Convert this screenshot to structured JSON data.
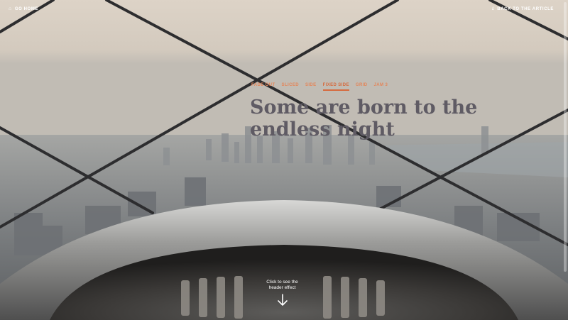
{
  "nav": {
    "home_label": "GO HOME",
    "home_icon": "home-icon",
    "back_label": "BACK TO THE ARTICLE",
    "back_icon": "drop-icon"
  },
  "effects": {
    "tabs": [
      {
        "label": "FADE OUT",
        "active": false
      },
      {
        "label": "SLICED",
        "active": false
      },
      {
        "label": "SIDE",
        "active": false
      },
      {
        "label": "FIXED SIDE",
        "active": true
      },
      {
        "label": "GRID",
        "active": false
      },
      {
        "label": "JAM 3",
        "active": false
      }
    ],
    "accent_color": "#d66a3e"
  },
  "hero": {
    "title": "Some are born to the endless night"
  },
  "cta": {
    "line1": "Click to see the",
    "line2": "header effect",
    "icon": "arrow-down-icon"
  }
}
